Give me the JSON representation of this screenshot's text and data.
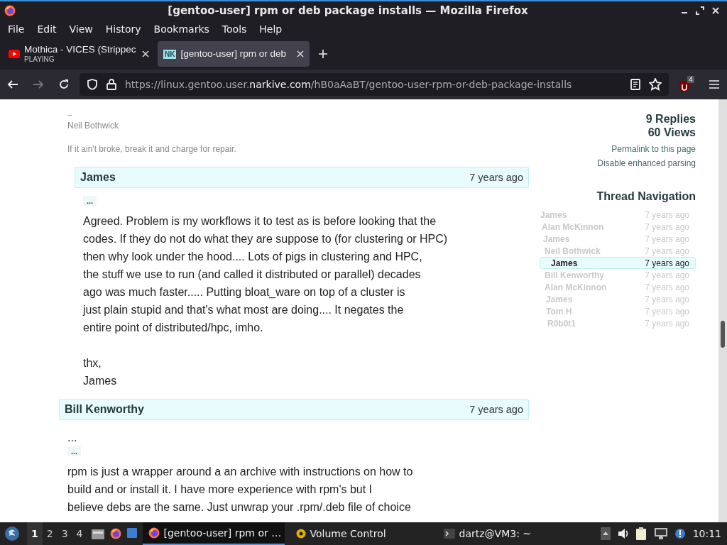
{
  "window": {
    "title": "[gentoo-user] rpm or deb package installs — Mozilla Firefox"
  },
  "menu": [
    {
      "label": "File"
    },
    {
      "label": "Edit"
    },
    {
      "label": "View"
    },
    {
      "label": "History"
    },
    {
      "label": "Bookmarks"
    },
    {
      "label": "Tools"
    },
    {
      "label": "Help"
    }
  ],
  "tabs": [
    {
      "kind": "media",
      "title": "Mothica - VICES (Strippec",
      "subtitle": "PLAYING",
      "selected": false
    },
    {
      "kind": "site",
      "favicon": "NK",
      "title": "[gentoo-user] rpm or deb",
      "selected": true
    }
  ],
  "navigation": {
    "forward_disabled": true,
    "url_prefix": "https://linux.gentoo.user.",
    "url_domain": "narkive.com",
    "url_path": "/hB0aAaBT/gentoo-user-rpm-or-deb-package-installs",
    "extension_badge": "4"
  },
  "thread": {
    "posts": [
      {
        "kind": "tail",
        "signature_dash": "--",
        "signature_name": "Neil Bothwick",
        "signature_quote": "If it ain't broke, break it and charge for repair.",
        "children": [
          {
            "kind": "post",
            "author": "James",
            "time": "7 years ago",
            "quote_toggle": "...",
            "paragraphs": [
              "Agreed. Problem is my workflows it to test as is before looking that the\ncodes. If they do not do what they are suppose to (for clustering or HPC)\nthen why look under the hood.... Lots of pigs in clustering and HPC,\nthe stuff we use to run (and called it distributed or parallel) decades\nago was much faster..... Putting bloat_ware on top of a cluster is\njust plain stupid and that's what most are doing.... It negates the\nentire point of distributed/hpc, imho.",
              "thx,\nJames"
            ]
          }
        ]
      },
      {
        "kind": "post",
        "author": "Bill Kenworthy",
        "time": "7 years ago",
        "lead": "...",
        "quote_toggle": "...",
        "paragraphs": [
          "rpm is just a wrapper around a an archive with instructions on how to\nbuild and or install it. I have more experience with rpm's but I\nbelieve debs are the same. Just unwrap your .rpm/.deb file of choice"
        ]
      }
    ]
  },
  "sidebar": {
    "replies": "9 Replies",
    "views": "60 Views",
    "links": [
      "Permalink to this page",
      "Disable enhanced parsing"
    ],
    "heading": "Thread Navigation",
    "navigation": [
      {
        "author": "James",
        "time": "7 years ago",
        "selected": false,
        "children": [
          {
            "author": "Alan McKinnon",
            "time": "7 years ago",
            "selected": false,
            "children": [
              {
                "author": "James",
                "time": "7 years ago",
                "selected": false,
                "children": [
                  {
                    "author": "Neil Bothwick",
                    "time": "7 years ago",
                    "selected": false,
                    "children": [
                      {
                        "author": "James",
                        "time": "7 years ago",
                        "selected": true
                      }
                    ]
                  },
                  {
                    "author": "Bill Kenworthy",
                    "time": "7 years ago",
                    "selected": false
                  },
                  {
                    "author": "Alan McKinnon",
                    "time": "7 years ago",
                    "selected": false,
                    "children": [
                      {
                        "author": "James",
                        "time": "7 years ago",
                        "selected": false
                      },
                      {
                        "author": "Tom H",
                        "time": "7 years ago",
                        "selected": false,
                        "children": [
                          {
                            "author": "R0b0t1",
                            "time": "7 years ago",
                            "selected": false
                          }
                        ]
                      }
                    ]
                  }
                ]
              }
            ]
          }
        ]
      }
    ]
  },
  "taskbar": {
    "workspaces": [
      {
        "label": "1",
        "selected": true
      },
      {
        "label": "2",
        "selected": false
      },
      {
        "label": "3",
        "selected": false
      },
      {
        "label": "4",
        "selected": false
      }
    ],
    "tasks": [
      {
        "kind": "browser",
        "label": "[gentoo-user] rpm or …",
        "selected": true
      },
      {
        "kind": "volume",
        "label": "Volume Control",
        "selected": false
      },
      {
        "kind": "terminal",
        "label": "dartz@VM3: ~",
        "selected": false
      }
    ],
    "clock": "10:11"
  }
}
